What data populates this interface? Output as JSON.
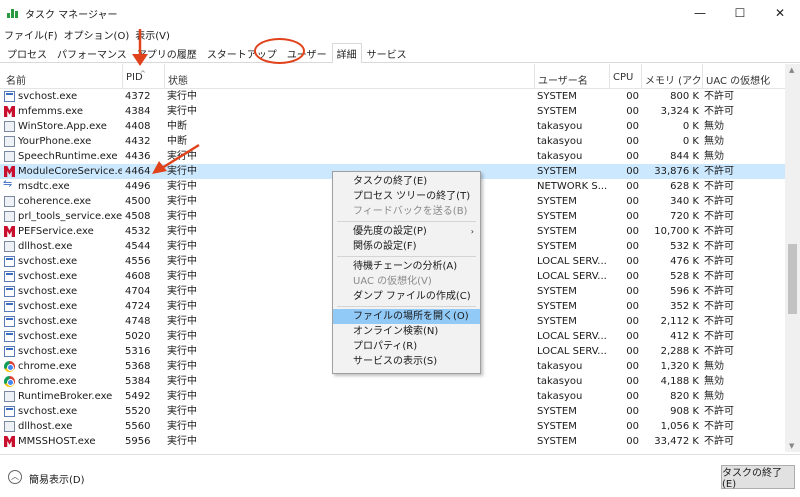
{
  "window": {
    "title": "タスク マネージャー",
    "controls": [
      "—",
      "☐",
      "✕"
    ]
  },
  "menu": [
    "ファイル(F)",
    "オプション(O)",
    "表示(V)"
  ],
  "tabs": [
    {
      "label": "プロセス"
    },
    {
      "label": "パフォーマンス"
    },
    {
      "label": "アプリの履歴"
    },
    {
      "label": "スタートアップ"
    },
    {
      "label": "ユーザー"
    },
    {
      "label": "詳細",
      "active": true
    },
    {
      "label": "サービス"
    }
  ],
  "columns": {
    "name": "名前",
    "pid": "PID",
    "status": "状態",
    "user": "ユーザー名",
    "cpu": "CPU",
    "memory": "メモリ (アクテ...",
    "uac": "UAC の仮想化"
  },
  "rows": [
    {
      "icon": "svc",
      "name": "svchost.exe",
      "pid": "4372",
      "status": "実行中",
      "user": "SYSTEM",
      "cpu": "00",
      "mem": "800 K",
      "uac": "不許可"
    },
    {
      "icon": "mcafee",
      "name": "mfemms.exe",
      "pid": "4384",
      "status": "実行中",
      "user": "SYSTEM",
      "cpu": "00",
      "mem": "3,324 K",
      "uac": "不許可"
    },
    {
      "icon": "app",
      "name": "WinStore.App.exe",
      "pid": "4408",
      "status": "中断",
      "user": "takasyou",
      "cpu": "00",
      "mem": "0 K",
      "uac": "無効"
    },
    {
      "icon": "app",
      "name": "YourPhone.exe",
      "pid": "4432",
      "status": "中断",
      "user": "takasyou",
      "cpu": "00",
      "mem": "0 K",
      "uac": "無効"
    },
    {
      "icon": "app",
      "name": "SpeechRuntime.exe",
      "pid": "4436",
      "status": "実行中",
      "user": "takasyou",
      "cpu": "00",
      "mem": "844 K",
      "uac": "無効"
    },
    {
      "icon": "mcafee",
      "name": "ModuleCoreService.e...",
      "pid": "4464",
      "status": "実行中",
      "user": "SYSTEM",
      "cpu": "00",
      "mem": "33,876 K",
      "uac": "不許可",
      "selected": true
    },
    {
      "icon": "net",
      "name": "msdtc.exe",
      "pid": "4496",
      "status": "実行中",
      "user": "NETWORK S...",
      "cpu": "00",
      "mem": "628 K",
      "uac": "不許可"
    },
    {
      "icon": "app",
      "name": "coherence.exe",
      "pid": "4500",
      "status": "実行中",
      "user": "SYSTEM",
      "cpu": "00",
      "mem": "340 K",
      "uac": "不許可"
    },
    {
      "icon": "app",
      "name": "prl_tools_service.exe",
      "pid": "4508",
      "status": "実行中",
      "user": "SYSTEM",
      "cpu": "00",
      "mem": "720 K",
      "uac": "不許可"
    },
    {
      "icon": "mcafee",
      "name": "PEFService.exe",
      "pid": "4532",
      "status": "実行中",
      "user": "SYSTEM",
      "cpu": "00",
      "mem": "10,700 K",
      "uac": "不許可"
    },
    {
      "icon": "app",
      "name": "dllhost.exe",
      "pid": "4544",
      "status": "実行中",
      "user": "SYSTEM",
      "cpu": "00",
      "mem": "532 K",
      "uac": "不許可"
    },
    {
      "icon": "svc",
      "name": "svchost.exe",
      "pid": "4556",
      "status": "実行中",
      "user": "LOCAL SERV...",
      "cpu": "00",
      "mem": "476 K",
      "uac": "不許可"
    },
    {
      "icon": "svc",
      "name": "svchost.exe",
      "pid": "4608",
      "status": "実行中",
      "user": "LOCAL SERV...",
      "cpu": "00",
      "mem": "528 K",
      "uac": "不許可"
    },
    {
      "icon": "svc",
      "name": "svchost.exe",
      "pid": "4704",
      "status": "実行中",
      "user": "SYSTEM",
      "cpu": "00",
      "mem": "596 K",
      "uac": "不許可"
    },
    {
      "icon": "svc",
      "name": "svchost.exe",
      "pid": "4724",
      "status": "実行中",
      "user": "SYSTEM",
      "cpu": "00",
      "mem": "352 K",
      "uac": "不許可"
    },
    {
      "icon": "svc",
      "name": "svchost.exe",
      "pid": "4748",
      "status": "実行中",
      "user": "SYSTEM",
      "cpu": "00",
      "mem": "2,112 K",
      "uac": "不許可"
    },
    {
      "icon": "svc",
      "name": "svchost.exe",
      "pid": "5020",
      "status": "実行中",
      "user": "LOCAL SERV...",
      "cpu": "00",
      "mem": "412 K",
      "uac": "不許可"
    },
    {
      "icon": "svc",
      "name": "svchost.exe",
      "pid": "5316",
      "status": "実行中",
      "user": "LOCAL SERV...",
      "cpu": "00",
      "mem": "2,288 K",
      "uac": "不許可"
    },
    {
      "icon": "chrome",
      "name": "chrome.exe",
      "pid": "5368",
      "status": "実行中",
      "user": "takasyou",
      "cpu": "00",
      "mem": "1,320 K",
      "uac": "無効"
    },
    {
      "icon": "chrome",
      "name": "chrome.exe",
      "pid": "5384",
      "status": "実行中",
      "user": "takasyou",
      "cpu": "00",
      "mem": "4,188 K",
      "uac": "無効"
    },
    {
      "icon": "app",
      "name": "RuntimeBroker.exe",
      "pid": "5492",
      "status": "実行中",
      "user": "takasyou",
      "cpu": "00",
      "mem": "820 K",
      "uac": "無効"
    },
    {
      "icon": "svc",
      "name": "svchost.exe",
      "pid": "5520",
      "status": "実行中",
      "user": "SYSTEM",
      "cpu": "00",
      "mem": "908 K",
      "uac": "不許可"
    },
    {
      "icon": "app",
      "name": "dllhost.exe",
      "pid": "5560",
      "status": "実行中",
      "user": "SYSTEM",
      "cpu": "00",
      "mem": "1,056 K",
      "uac": "不許可"
    },
    {
      "icon": "mcafee",
      "name": "MMSSHOST.exe",
      "pid": "5956",
      "status": "実行中",
      "user": "SYSTEM",
      "cpu": "00",
      "mem": "33,472 K",
      "uac": "不許可"
    }
  ],
  "context_menu": [
    {
      "label": "タスクの終了(E)"
    },
    {
      "label": "プロセス ツリーの終了(T)"
    },
    {
      "label": "フィードバックを送る(B)",
      "disabled": true
    },
    {
      "separator": true
    },
    {
      "label": "優先度の設定(P)",
      "submenu": true
    },
    {
      "label": "関係の設定(F)"
    },
    {
      "separator": true
    },
    {
      "label": "待機チェーンの分析(A)"
    },
    {
      "label": "UAC の仮想化(V)",
      "disabled": true
    },
    {
      "label": "ダンプ ファイルの作成(C)"
    },
    {
      "separator": true
    },
    {
      "label": "ファイルの場所を開く(O)",
      "hover": true
    },
    {
      "label": "オンライン検索(N)"
    },
    {
      "label": "プロパティ(R)"
    },
    {
      "label": "サービスの表示(S)"
    }
  ],
  "footer": {
    "fewer_details": "簡易表示(D)",
    "end_task": "タスクの終了(E)"
  },
  "colors": {
    "selected_row": "#cce8ff",
    "menu_hover": "#91c9f7",
    "annotation": "#e0421b"
  }
}
